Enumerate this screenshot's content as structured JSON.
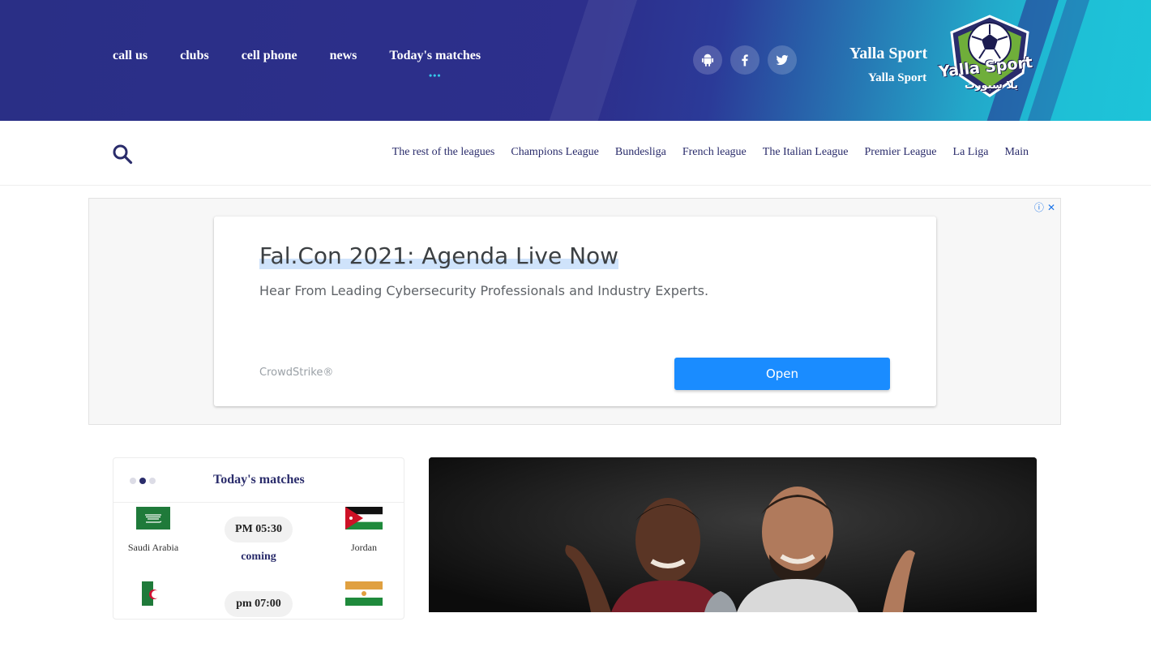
{
  "header": {
    "nav": [
      {
        "label": "call us"
      },
      {
        "label": "clubs"
      },
      {
        "label": "cell phone"
      },
      {
        "label": "news"
      },
      {
        "label": "Today's matches",
        "active": true
      }
    ],
    "socials": [
      {
        "icon": "android-icon"
      },
      {
        "icon": "facebook-icon"
      },
      {
        "icon": "twitter-icon"
      }
    ],
    "site_title": "Yalla Sport",
    "site_subtitle": "Yalla Sport",
    "logo_text": "Yalla Sport",
    "logo_text_ar": "يلا سبورت"
  },
  "leagues_nav": [
    {
      "label": "The rest of the leagues"
    },
    {
      "label": "Champions League"
    },
    {
      "label": "Bundesliga"
    },
    {
      "label": "French league"
    },
    {
      "label": "The Italian League"
    },
    {
      "label": "Premier League"
    },
    {
      "label": "La Liga"
    },
    {
      "label": "Main"
    }
  ],
  "ad": {
    "title": "Fal.Con 2021: Agenda Live Now",
    "description": "Hear From Leading Cybersecurity Professionals and Industry Experts.",
    "advertiser": "CrowdStrike®",
    "cta": "Open"
  },
  "matches_widget": {
    "title": "Today's matches",
    "active_page": 2,
    "matches": [
      {
        "home": "Saudi Arabia",
        "time": "PM 05:30",
        "status": "coming",
        "away": "Jordan"
      },
      {
        "home": "",
        "time": "pm 07:00",
        "status": "",
        "away": ""
      }
    ]
  },
  "colors": {
    "primary": "#2a2c6b",
    "banner": "#2d2f8c",
    "accent": "#1ebfd6",
    "ad_button": "#1a8cff"
  }
}
